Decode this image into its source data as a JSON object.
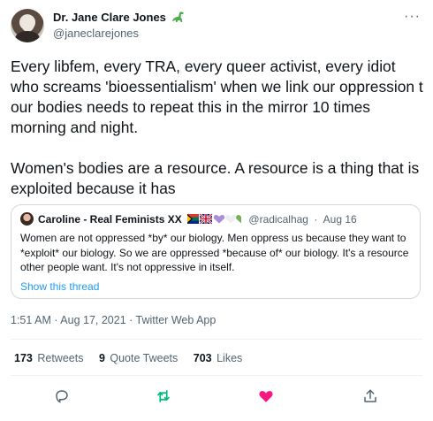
{
  "author": {
    "name": "Dr. Jane Clare Jones",
    "emoji_icon": "dinosaur-icon",
    "handle": "@janeclarejones"
  },
  "tweet": {
    "paragraphs": [
      "Every libfem, every TRA, every queer activist, every idiot who screams 'bioessentialism' when we link our oppression t our bodies needs to repeat this in the mirror 10 times morning and night.",
      "Women's bodies are a resource. A resource is a thing that is exploited because it has"
    ]
  },
  "quote": {
    "name": "Caroline - Real Feminists XX",
    "emoji": [
      "south-africa-flag-icon",
      "uk-flag-icon",
      "purple-heart-icon",
      "white-heart-icon",
      "green-heart-icon"
    ],
    "handle": "@radicalhag",
    "separator": "·",
    "date": "Aug 16",
    "text": "Women are not oppressed *by* our biology.  Men oppress us because they want to *exploit* our biology.  So we are oppressed *because of* our biology.  It's a resource other people want.  It's not oppressive in itself.",
    "thread_link": "Show this thread"
  },
  "timestamp": "1:51 AM · Aug 17, 2021 · Twitter Web App",
  "stats": {
    "retweets": {
      "count": "173",
      "label": "Retweets"
    },
    "quotes": {
      "count": "9",
      "label": "Quote Tweets"
    },
    "likes": {
      "count": "703",
      "label": "Likes"
    }
  },
  "actions": [
    "reply-icon",
    "retweet-icon",
    "like-icon",
    "share-icon"
  ],
  "colors": {
    "text": "#0f1419",
    "secondary": "#536471",
    "link": "#1d9bf0",
    "retweet": "#00ba7c",
    "like": "#f91880",
    "border": "#cfd9de"
  }
}
